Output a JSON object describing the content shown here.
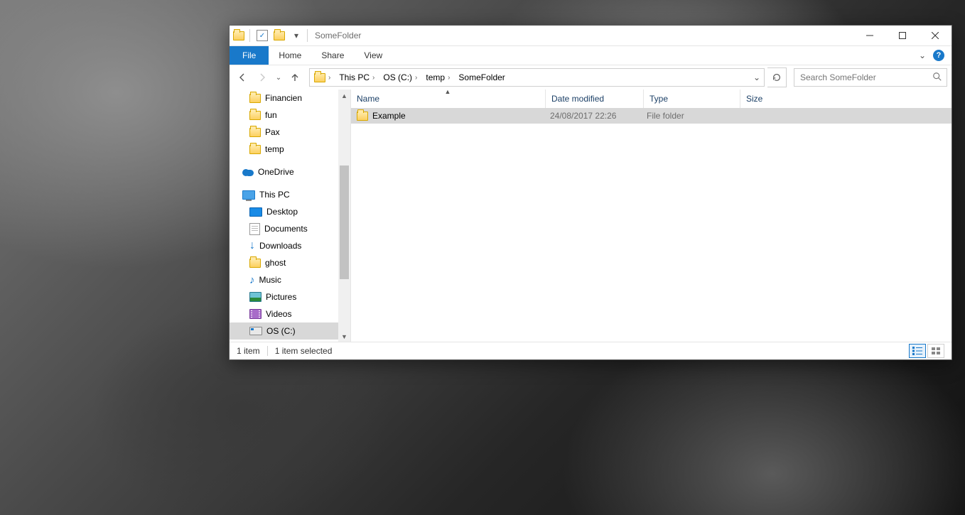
{
  "window": {
    "title": "SomeFolder"
  },
  "ribbon": {
    "file": "File",
    "tabs": [
      "Home",
      "Share",
      "View"
    ]
  },
  "breadcrumbs": [
    "This PC",
    "OS (C:)",
    "temp",
    "SomeFolder"
  ],
  "search": {
    "placeholder": "Search SomeFolder"
  },
  "navpane": {
    "quick": [
      {
        "label": "Financien",
        "icon": "folder"
      },
      {
        "label": "fun",
        "icon": "folder"
      },
      {
        "label": "Pax",
        "icon": "folder"
      },
      {
        "label": "temp",
        "icon": "folder"
      }
    ],
    "onedrive": {
      "label": "OneDrive"
    },
    "thispc": {
      "label": "This PC",
      "children": [
        {
          "label": "Desktop",
          "icon": "desktop"
        },
        {
          "label": "Documents",
          "icon": "doc"
        },
        {
          "label": "Downloads",
          "icon": "dl"
        },
        {
          "label": "ghost",
          "icon": "folder"
        },
        {
          "label": "Music",
          "icon": "music"
        },
        {
          "label": "Pictures",
          "icon": "pic"
        },
        {
          "label": "Videos",
          "icon": "vid"
        },
        {
          "label": "OS (C:)",
          "icon": "drive",
          "selected": true
        }
      ]
    }
  },
  "columns": {
    "name": "Name",
    "date": "Date modified",
    "type": "Type",
    "size": "Size"
  },
  "files": [
    {
      "name": "Example",
      "date": "24/08/2017 22:26",
      "type": "File folder",
      "size": "",
      "selected": true
    }
  ],
  "status": {
    "count": "1 item",
    "selection": "1 item selected"
  }
}
